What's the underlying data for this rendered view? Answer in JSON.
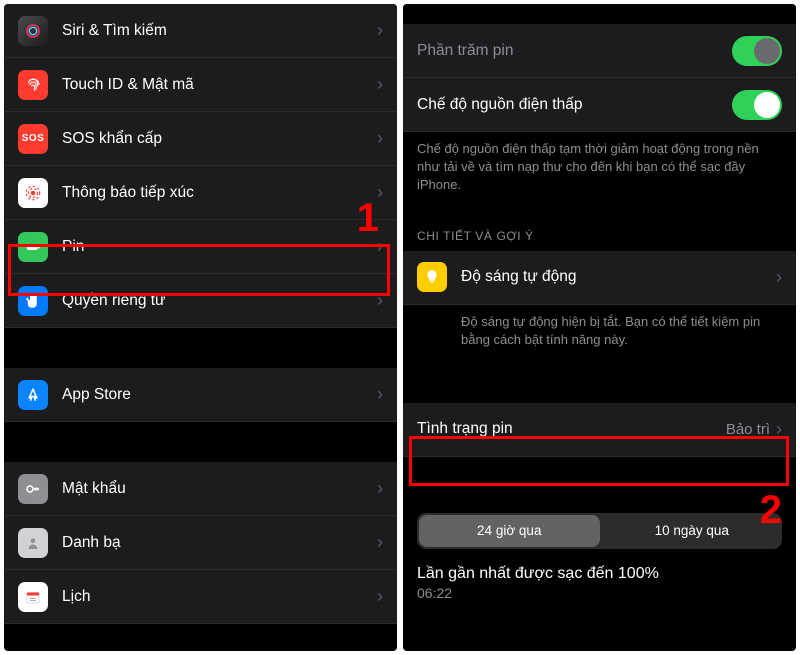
{
  "left": {
    "items": [
      {
        "label": "Siri & Tìm kiếm"
      },
      {
        "label": "Touch ID & Mật mã"
      },
      {
        "label": "SOS khẩn cấp"
      },
      {
        "label": "Thông báo tiếp xúc"
      },
      {
        "label": "Pin"
      },
      {
        "label": "Quyền riêng tư"
      },
      {
        "label": "App Store"
      },
      {
        "label": "Mật khẩu"
      },
      {
        "label": "Danh bạ"
      },
      {
        "label": "Lịch"
      }
    ],
    "annotation": "1"
  },
  "right": {
    "battery_percent_label": "Phần trăm pin",
    "low_power_label": "Chế độ nguồn điện thấp",
    "low_power_desc": "Chế độ nguồn điện thấp tạm thời giảm hoạt động trong nền như tải về và tìm nạp thư cho đến khi bạn có thể sạc đầy iPhone.",
    "section_suggestions": "CHI TIẾT VÀ GỢI Ý",
    "auto_brightness_label": "Độ sáng tự động",
    "auto_brightness_desc": "Độ sáng tự động hiện bị tắt. Bạn có thể tiết kiệm pin bằng cách bật tính năng này.",
    "battery_health_label": "Tình trạng pin",
    "battery_health_detail": "Bảo trì",
    "seg_24h": "24 giờ qua",
    "seg_10d": "10 ngày qua",
    "last_charge_label": "Lần gần nhất được sạc đến 100%",
    "last_charge_time": "06:22",
    "annotation": "2"
  }
}
